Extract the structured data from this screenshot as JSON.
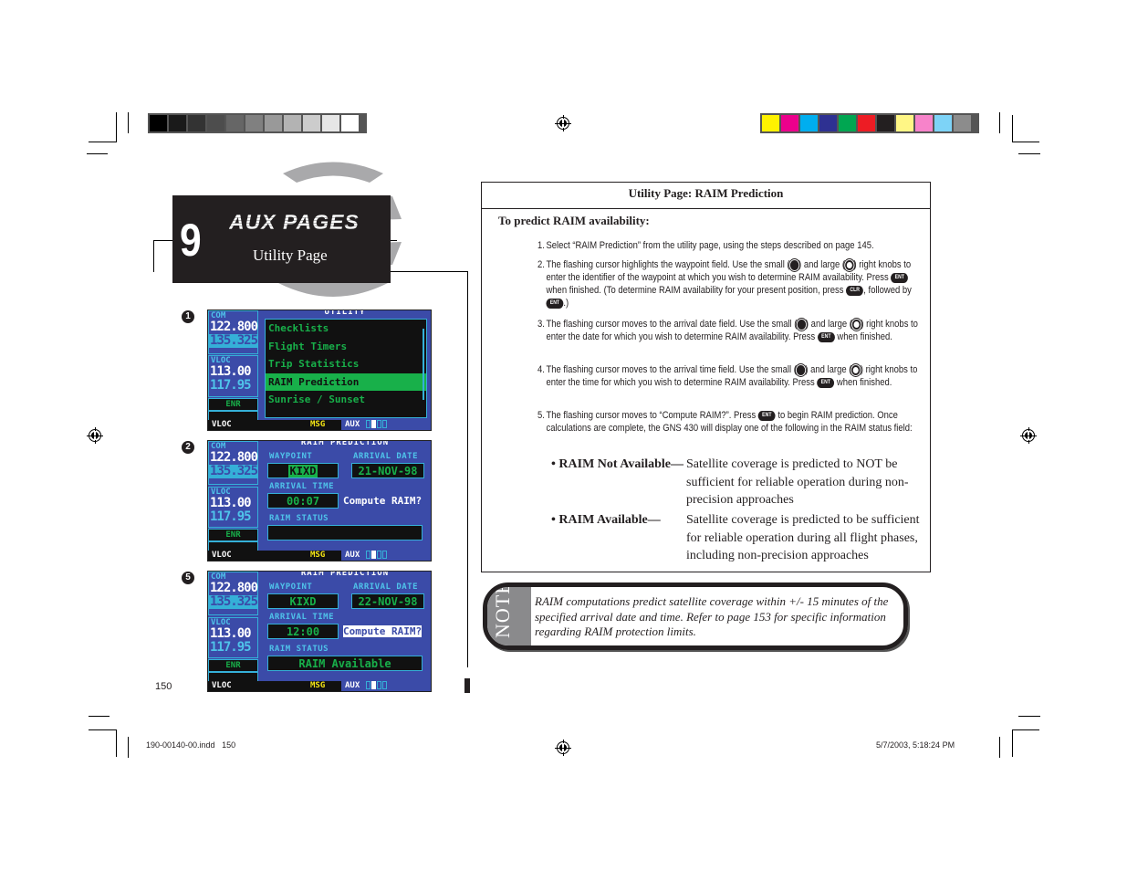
{
  "registration": {
    "grayscale_swatches": [
      "#000000",
      "#1a1a1a",
      "#333333",
      "#4d4d4d",
      "#666666",
      "#808080",
      "#999999",
      "#b3b3b3",
      "#cccccc",
      "#e6e6e6",
      "#ffffff"
    ],
    "color_swatches": [
      "#fff200",
      "#ec008c",
      "#00aeef",
      "#2e3192",
      "#00a651",
      "#ed1c24",
      "#231f20",
      "#fff685",
      "#f783ca",
      "#7dd3f7",
      "#8c8c8c"
    ]
  },
  "chapter": {
    "number": "9",
    "title": "AUX PAGES",
    "subtitle": "Utility Page"
  },
  "screens": [
    {
      "step": "1",
      "title": "UTILITY",
      "com_label": "COM",
      "com_active": "122.800",
      "com_standby": "135.325",
      "vloc_label": "VLOC",
      "vloc_active": "113.00",
      "vloc_standby": "117.95",
      "mode": "ENR",
      "menu": [
        "Checklists",
        "Flight Timers",
        "Trip Statistics",
        "RAIM Prediction",
        "Sunrise / Sunset"
      ],
      "selected_index": 3,
      "status": {
        "left": "VLOC",
        "msg": "MSG",
        "page": "AUX"
      }
    },
    {
      "step": "2",
      "title": "RAIM PREDICTION",
      "com_label": "COM",
      "com_active": "122.800",
      "com_standby": "135.325",
      "vloc_label": "VLOC",
      "vloc_active": "113.00",
      "vloc_standby": "117.95",
      "mode": "ENR",
      "waypoint_label": "WAYPOINT",
      "waypoint": "KIXD",
      "date_label": "ARRIVAL DATE",
      "date": "21-NOV-98",
      "time_label": "ARRIVAL TIME",
      "time": "00:07",
      "compute": "Compute RAIM?",
      "status_label": "RAIM STATUS",
      "raim_status": "",
      "status": {
        "left": "VLOC",
        "msg": "MSG",
        "page": "AUX"
      }
    },
    {
      "step": "5",
      "title": "RAIM PREDICTION",
      "com_label": "COM",
      "com_active": "122.800",
      "com_standby": "135.325",
      "vloc_label": "VLOC",
      "vloc_active": "113.00",
      "vloc_standby": "117.95",
      "mode": "ENR",
      "waypoint_label": "WAYPOINT",
      "waypoint": "KIXD",
      "date_label": "ARRIVAL DATE",
      "date": "22-NOV-98",
      "time_label": "ARRIVAL TIME",
      "time": "12:00",
      "compute": "Compute RAIM?",
      "status_label": "RAIM STATUS",
      "raim_status": "RAIM Available",
      "status": {
        "left": "VLOC",
        "msg": "MSG",
        "page": "AUX"
      }
    }
  ],
  "procedure": {
    "title": "Utility Page: RAIM Prediction",
    "intro": "To predict RAIM availability:",
    "steps": [
      {
        "n": "1.",
        "text": "Select “RAIM Prediction” from the utility page, using the steps described on page 145."
      },
      {
        "n": "2.",
        "a": "The flashing cursor highlights the waypoint field. Use the small (",
        "b": ") and large (",
        "c": ") right knobs to enter the identifier of the waypoint at which you wish to determine RAIM availability. Press ",
        "d": " when finished. (To determine RAIM availability for your present position, press ",
        "e": ", followed by ",
        "f": ".)"
      },
      {
        "n": "3.",
        "a": "The flashing cursor moves to the arrival date field. Use the small (",
        "b": ") and large (",
        "c": ") right knobs to enter the date for which you wish to determine RAIM availability. Press ",
        "d": " when finished."
      },
      {
        "n": "4.",
        "a": "The flashing cursor moves to the arrival time field. Use the small (",
        "b": ") and large (",
        "c": ") right knobs to enter the time for which you wish to determine RAIM availability. Press ",
        "d": " when finished."
      },
      {
        "n": "5.",
        "a": "The flashing cursor moves to “Compute RAIM?”. Press ",
        "b": " to begin RAIM prediction. Once calculations are complete, the GNS 430 will display one of the following in the RAIM status field:"
      }
    ],
    "keys": {
      "ent": "ENT",
      "clr": "CLR"
    },
    "bullets": [
      {
        "term": "• RAIM Not Available—",
        "desc": "Satellite coverage is predicted to NOT be sufficient for reliable operation during non-precision approaches"
      },
      {
        "term": "• RAIM Available—",
        "desc": "Satellite coverage is predicted to be sufficient for reliable operation during all flight phases, including non-precision approaches"
      }
    ]
  },
  "note": {
    "label": "NOTE",
    "text": "RAIM computations predict satellite coverage within +/- 15 minutes of the specified arrival date and time. Refer to page 153 for specific information regarding RAIM protection limits."
  },
  "footer": {
    "page_number": "150",
    "file": "190-00140-00.indd   150",
    "timestamp": "5/7/2003, 5:18:24 PM"
  }
}
